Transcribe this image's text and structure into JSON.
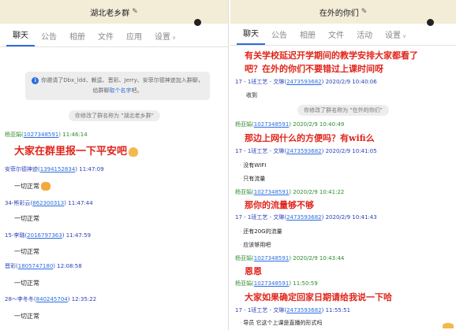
{
  "left": {
    "title": "湖北老乡群",
    "tabs": [
      {
        "label": "聊天",
        "active": true
      },
      {
        "label": "公告"
      },
      {
        "label": "相册"
      },
      {
        "label": "文件"
      },
      {
        "label": "应用"
      },
      {
        "label": "设置"
      }
    ],
    "notice": {
      "text": "你邀请了Dbx_ldd、赖逵、晋彩、Jerry、安菲尔德神迹加入群聊，给群聊",
      "link": "取个名字",
      "tail": "吧。"
    },
    "rename": "你修改了群名称为 \"湖北老乡群\"",
    "messages": [
      {
        "name": "杨亚娟",
        "id": "1027348591",
        "time": "11:46:14",
        "text": "大家在群里报一下平安吧",
        "big": true,
        "emoji": "hand"
      },
      {
        "name": "安菲尔德神迹",
        "id": "1394152834",
        "time": "11:47:09",
        "text": "一切正常",
        "emoji": "clap"
      },
      {
        "name": "34-熊彩云",
        "id": "862300313",
        "time": "11:47:44",
        "text": "一切正常"
      },
      {
        "name": "15-李璐",
        "id": "2016797363",
        "time": "11:47:59",
        "text": "一切正常"
      },
      {
        "name": "晋彩",
        "id": "1805747180",
        "time": "12:08:58",
        "text": "一切正常"
      },
      {
        "name": "28～李冬冬",
        "id": "840245704",
        "time": "12:35:22",
        "text": "一切正常"
      }
    ]
  },
  "right": {
    "title": "在外的你们",
    "tabs": [
      {
        "label": "聊天",
        "active": true
      },
      {
        "label": "公告"
      },
      {
        "label": "相册"
      },
      {
        "label": "文件"
      },
      {
        "label": "活动"
      },
      {
        "label": "设置"
      }
    ],
    "top_big_1": "有关学校延迟开学期间的教学安排大家都看了",
    "top_big_2": "吧？在外的你们不要错过上课时间呀",
    "rename": "你修改了群名称为 \"在外的你们\"",
    "messages": [
      {
        "name": "17 - 1班工艺 - 文琳",
        "id": "2473593682",
        "time": "2020/2/9 10:40:06",
        "lines": [
          "收到"
        ]
      },
      {
        "name": "杨亚娟",
        "id": "1027348591",
        "time": "2020/2/9 10:40:49",
        "big": "那边上网什么的方便吗？有wifi么"
      },
      {
        "name": "17 - 1班工艺 - 文琳",
        "id": "2473593682",
        "time": "2020/2/9 10:41:05",
        "lines": [
          "没有WIFI",
          "只有流量"
        ]
      },
      {
        "name": "杨亚娟",
        "id": "1027348591",
        "time": "2020/2/9 10:41:22",
        "big": "那你的流量够不够"
      },
      {
        "name": "17 - 1班工艺 - 文琳",
        "id": "2473593682",
        "time": "2020/2/9 10:41:43",
        "lines": [
          "还有20G的流量",
          "应该够用吧"
        ]
      },
      {
        "name": "杨亚娟",
        "id": "1027348591",
        "time": "2020/2/9 10:43:44",
        "big": "恩恩"
      },
      {
        "name": "杨亚娟",
        "id": "1027348591",
        "time": "11:50:59",
        "big": "大家如果确定回家日期请给我说一下哈"
      },
      {
        "name": "17 - 1班工艺 - 文琳",
        "id": "2473593682",
        "time": "11:55:51",
        "lines": [
          "导员 它这个上课是直播的形式吗"
        ]
      }
    ]
  }
}
